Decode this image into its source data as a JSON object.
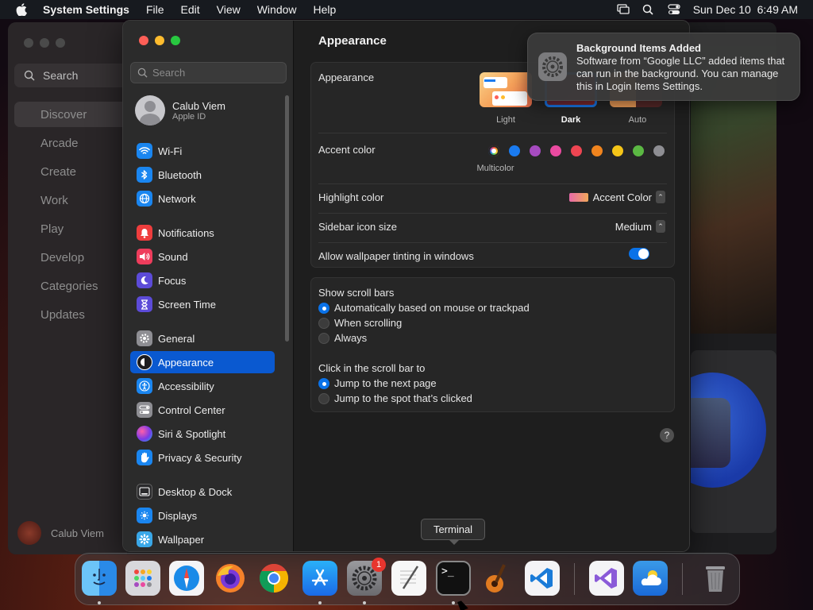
{
  "menubar": {
    "app_name": "System Settings",
    "menus": [
      "File",
      "Edit",
      "View",
      "Window",
      "Help"
    ],
    "clock": "Sun Dec 10  6:49 AM"
  },
  "appstore": {
    "search_label": "Search",
    "items": [
      "Discover",
      "Arcade",
      "Create",
      "Work",
      "Play",
      "Develop",
      "Categories",
      "Updates"
    ],
    "user_name": "Calub Viem"
  },
  "settings": {
    "search_placeholder": "Search",
    "profile": {
      "name": "Calub Viem",
      "sub": "Apple ID"
    },
    "nav": [
      {
        "label": "Wi-Fi",
        "color": "#1a86f0",
        "icon": "wifi-icon"
      },
      {
        "label": "Bluetooth",
        "color": "#1a86f0",
        "icon": "bluetooth-icon"
      },
      {
        "label": "Network",
        "color": "#1a86f0",
        "icon": "globe-icon"
      },
      {
        "label": "Notifications",
        "color": "#ee3d3d",
        "icon": "bell-icon"
      },
      {
        "label": "Sound",
        "color": "#ee3d5c",
        "icon": "speaker-icon"
      },
      {
        "label": "Focus",
        "color": "#5c4bd8",
        "icon": "moon-icon"
      },
      {
        "label": "Screen Time",
        "color": "#5c4bd8",
        "icon": "hourglass-icon"
      },
      {
        "label": "General",
        "color": "#8e8e93",
        "icon": "gear-icon"
      },
      {
        "label": "Appearance",
        "color": "#1c1c1e",
        "icon": "appearance-icon"
      },
      {
        "label": "Accessibility",
        "color": "#1a86f0",
        "icon": "accessibility-icon"
      },
      {
        "label": "Control Center",
        "color": "#8e8e93",
        "icon": "control-center-icon"
      },
      {
        "label": "Siri & Spotlight",
        "color": "#b43ad8",
        "icon": "siri-icon"
      },
      {
        "label": "Privacy & Security",
        "color": "#1a86f0",
        "icon": "hand-icon"
      },
      {
        "label": "Desktop & Dock",
        "color": "#2a2a2c",
        "icon": "dock-icon"
      },
      {
        "label": "Displays",
        "color": "#1a86f0",
        "icon": "display-icon"
      },
      {
        "label": "Wallpaper",
        "color": "#3aa8e8",
        "icon": "wallpaper-icon"
      }
    ],
    "selected": "Appearance",
    "title": "Appearance",
    "appearance": {
      "label": "Appearance",
      "options": [
        "Light",
        "Dark",
        "Auto"
      ],
      "selected": "Dark"
    },
    "accent": {
      "label": "Accent color",
      "colors": [
        "multicolor",
        "#1a7bf0",
        "#a64bc0",
        "#ea4aa0",
        "#ee4552",
        "#f0841e",
        "#f5c518",
        "#5bb843",
        "#8e8e93"
      ],
      "selected_label": "Multicolor"
    },
    "highlight": {
      "label": "Highlight color",
      "value": "Accent Color"
    },
    "sidebar_icon": {
      "label": "Sidebar icon size",
      "value": "Medium"
    },
    "tinting": {
      "label": "Allow wallpaper tinting in windows",
      "on": true
    },
    "scrollbars": {
      "label": "Show scroll bars",
      "options": [
        "Automatically based on mouse or trackpad",
        "When scrolling",
        "Always"
      ],
      "selected": 0
    },
    "click_scroll": {
      "label": "Click in the scroll bar to",
      "options": [
        "Jump to the next page",
        "Jump to the spot that’s clicked"
      ],
      "selected": 0
    },
    "help": "?"
  },
  "notification": {
    "title": "Background Items Added",
    "body": "Software from “Google LLC” added items that can run in the background. You can manage this in Login Items Settings."
  },
  "tooltip": "Terminal",
  "dock": {
    "badge": "1",
    "apps": [
      "Finder",
      "Launchpad",
      "Safari",
      "Firefox",
      "Chrome",
      "App Store",
      "System Settings",
      "TextEdit",
      "Terminal",
      "GarageBand",
      "VS Code",
      "Visual Studio",
      "Weather",
      "Trash"
    ]
  }
}
